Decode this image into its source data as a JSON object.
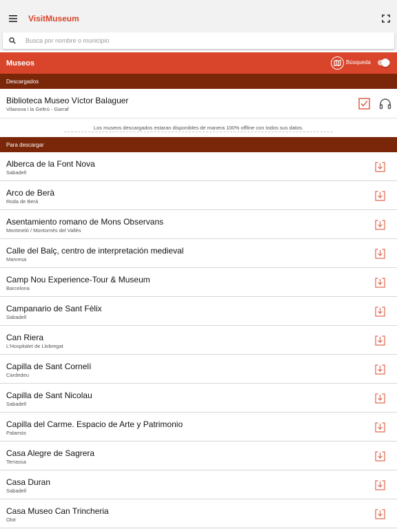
{
  "app": {
    "title": "VisitMuseum"
  },
  "search": {
    "placeholder": "Busca por nombre o municipio",
    "value": ""
  },
  "header": {
    "title": "Museos",
    "search_toggle_label": "Búsqueda",
    "search_toggle_on": false
  },
  "downloaded": {
    "section_label": "Descargados",
    "items": [
      {
        "name": "Biblioteca Museo Víctor Balaguer",
        "city": "Vilanova i la Geltrú - Garraf"
      }
    ],
    "note": "Los museos descargados estaran disponibles de manera 100% offline con todos sus datos."
  },
  "to_download": {
    "section_label": "Para descargar",
    "items": [
      {
        "name": "Alberca de la Font Nova",
        "city": "Sabadell"
      },
      {
        "name": "Arco de Berà",
        "city": "Roda de Berà"
      },
      {
        "name": "Asentamiento romano de Mons Observans",
        "city": "Montmeló / Montornès del Vallès"
      },
      {
        "name": "Calle del Balç, centro de interpretación medieval",
        "city": "Manresa"
      },
      {
        "name": "Camp Nou Experience-Tour & Museum",
        "city": "Barcelona"
      },
      {
        "name": "Campanario de Sant Fèlix",
        "city": "Sabadell"
      },
      {
        "name": "Can Riera",
        "city": "L'Hospitalet de Llobregat"
      },
      {
        "name": "Capilla de Sant Cornelí",
        "city": "Cardedeu"
      },
      {
        "name": "Capilla de Sant Nicolau",
        "city": "Sabadell"
      },
      {
        "name": "Capilla del Carme. Espacio de Arte y Patrimonio",
        "city": "Palamós"
      },
      {
        "name": "Casa Alegre de Sagrera",
        "city": "Terrassa"
      },
      {
        "name": "Casa Duran",
        "city": "Sabadell"
      },
      {
        "name": "Casa Museo Can Trincheria",
        "city": "Olot"
      }
    ]
  },
  "icons": {
    "menu": "menu-icon",
    "fullscreen": "fullscreen-icon",
    "search": "search-icon",
    "map": "map-icon",
    "downloaded_check": "checkbox-checked-icon",
    "audio": "headphones-icon",
    "download": "download-icon"
  },
  "colors": {
    "accent": "#d9452b",
    "section_header": "#7a2609",
    "appbar": "#f2f2f2"
  }
}
